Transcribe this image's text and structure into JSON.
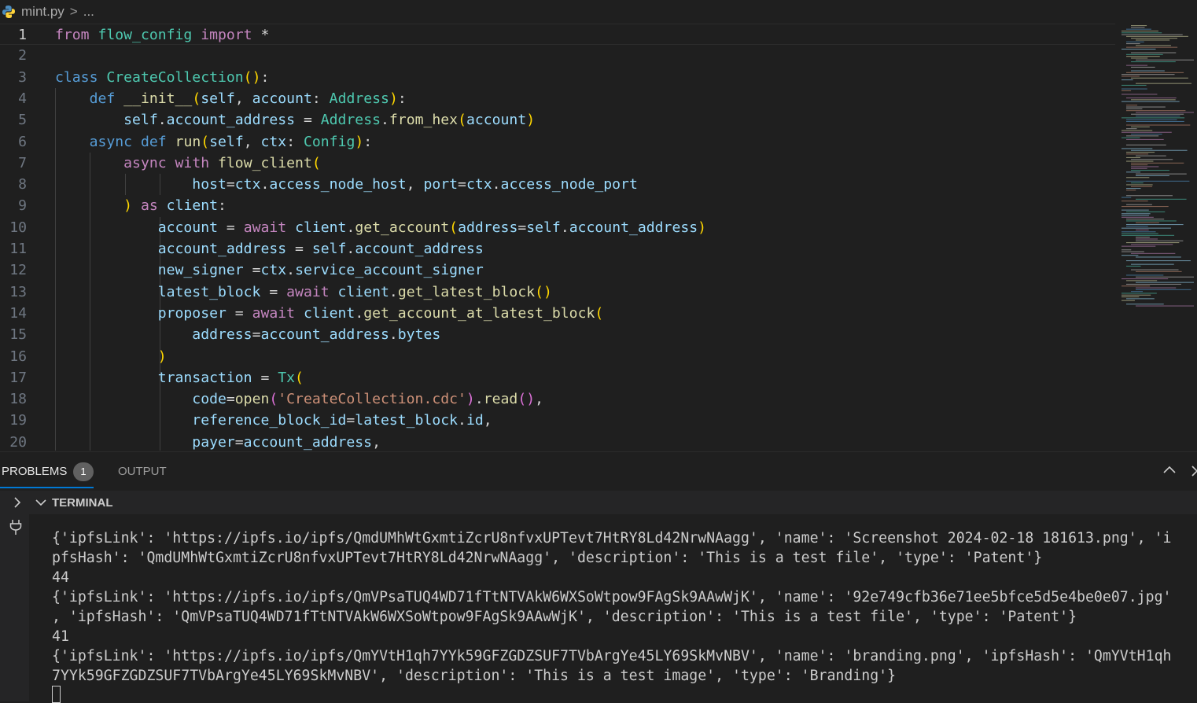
{
  "breadcrumb": {
    "file": "mint.py",
    "separator": ">",
    "ellipsis": "..."
  },
  "editor": {
    "current_line": 1,
    "lines": [
      {
        "n": "1"
      },
      {
        "n": "2"
      },
      {
        "n": "3"
      },
      {
        "n": "4"
      },
      {
        "n": "5"
      },
      {
        "n": "6"
      },
      {
        "n": "7"
      },
      {
        "n": "8"
      },
      {
        "n": "9"
      },
      {
        "n": "10"
      },
      {
        "n": "11"
      },
      {
        "n": "12"
      },
      {
        "n": "13"
      },
      {
        "n": "14"
      },
      {
        "n": "15"
      },
      {
        "n": "16"
      },
      {
        "n": "17"
      },
      {
        "n": "18"
      },
      {
        "n": "19"
      },
      {
        "n": "20"
      }
    ],
    "code": [
      [
        [
          "from",
          "kw"
        ],
        [
          " ",
          ""
        ],
        [
          "flow_config",
          "ty"
        ],
        [
          " ",
          ""
        ],
        [
          "import",
          "kw"
        ],
        [
          " *",
          "op"
        ]
      ],
      [],
      [
        [
          "class",
          "kw2"
        ],
        [
          " ",
          ""
        ],
        [
          "CreateCollection",
          "ty"
        ],
        [
          "()",
          "b1"
        ],
        [
          ":",
          "op"
        ]
      ],
      [
        [
          "    ",
          ""
        ],
        [
          "def",
          "kw2"
        ],
        [
          " ",
          ""
        ],
        [
          "__init__",
          "fn"
        ],
        [
          "(",
          "b1"
        ],
        [
          "self",
          "vr"
        ],
        [
          ", ",
          "op"
        ],
        [
          "account",
          "vr"
        ],
        [
          ": ",
          "op"
        ],
        [
          "Address",
          "ty"
        ],
        [
          ")",
          "b1"
        ],
        [
          ":",
          "op"
        ]
      ],
      [
        [
          "        ",
          ""
        ],
        [
          "self",
          "vr"
        ],
        [
          ".",
          "op"
        ],
        [
          "account_address",
          "vr"
        ],
        [
          " = ",
          "op"
        ],
        [
          "Address",
          "ty"
        ],
        [
          ".",
          "op"
        ],
        [
          "from_hex",
          "fn"
        ],
        [
          "(",
          "b1"
        ],
        [
          "account",
          "vr"
        ],
        [
          ")",
          "b1"
        ]
      ],
      [
        [
          "    ",
          ""
        ],
        [
          "async",
          "kw2"
        ],
        [
          " ",
          ""
        ],
        [
          "def",
          "kw2"
        ],
        [
          " ",
          ""
        ],
        [
          "run",
          "fn"
        ],
        [
          "(",
          "b1"
        ],
        [
          "self",
          "vr"
        ],
        [
          ", ",
          "op"
        ],
        [
          "ctx",
          "vr"
        ],
        [
          ": ",
          "op"
        ],
        [
          "Config",
          "ty"
        ],
        [
          ")",
          "b1"
        ],
        [
          ":",
          "op"
        ]
      ],
      [
        [
          "        ",
          ""
        ],
        [
          "async",
          "kw"
        ],
        [
          " ",
          ""
        ],
        [
          "with",
          "kw"
        ],
        [
          " ",
          ""
        ],
        [
          "flow_client",
          "fn"
        ],
        [
          "(",
          "b1"
        ]
      ],
      [
        [
          "                ",
          ""
        ],
        [
          "host",
          "vr"
        ],
        [
          "=",
          "op"
        ],
        [
          "ctx",
          "vr"
        ],
        [
          ".",
          "op"
        ],
        [
          "access_node_host",
          "vr"
        ],
        [
          ", ",
          "op"
        ],
        [
          "port",
          "vr"
        ],
        [
          "=",
          "op"
        ],
        [
          "ctx",
          "vr"
        ],
        [
          ".",
          "op"
        ],
        [
          "access_node_port",
          "vr"
        ]
      ],
      [
        [
          "        ",
          ""
        ],
        [
          ")",
          "b1"
        ],
        [
          " ",
          ""
        ],
        [
          "as",
          "kw"
        ],
        [
          " ",
          ""
        ],
        [
          "client",
          "vr"
        ],
        [
          ":",
          "op"
        ]
      ],
      [
        [
          "            ",
          ""
        ],
        [
          "account",
          "vr"
        ],
        [
          " = ",
          "op"
        ],
        [
          "await",
          "kw"
        ],
        [
          " ",
          ""
        ],
        [
          "client",
          "vr"
        ],
        [
          ".",
          "op"
        ],
        [
          "get_account",
          "fn"
        ],
        [
          "(",
          "b1"
        ],
        [
          "address",
          "vr"
        ],
        [
          "=",
          "op"
        ],
        [
          "self",
          "vr"
        ],
        [
          ".",
          "op"
        ],
        [
          "account_address",
          "vr"
        ],
        [
          ")",
          "b1"
        ]
      ],
      [
        [
          "            ",
          ""
        ],
        [
          "account_address",
          "vr"
        ],
        [
          " = ",
          "op"
        ],
        [
          "self",
          "vr"
        ],
        [
          ".",
          "op"
        ],
        [
          "account_address",
          "vr"
        ]
      ],
      [
        [
          "            ",
          ""
        ],
        [
          "new_signer",
          "vr"
        ],
        [
          " =",
          "op"
        ],
        [
          "ctx",
          "vr"
        ],
        [
          ".",
          "op"
        ],
        [
          "service_account_signer",
          "vr"
        ]
      ],
      [
        [
          "            ",
          ""
        ],
        [
          "latest_block",
          "vr"
        ],
        [
          " = ",
          "op"
        ],
        [
          "await",
          "kw"
        ],
        [
          " ",
          ""
        ],
        [
          "client",
          "vr"
        ],
        [
          ".",
          "op"
        ],
        [
          "get_latest_block",
          "fn"
        ],
        [
          "()",
          "b1"
        ]
      ],
      [
        [
          "            ",
          ""
        ],
        [
          "proposer",
          "vr"
        ],
        [
          " = ",
          "op"
        ],
        [
          "await",
          "kw"
        ],
        [
          " ",
          ""
        ],
        [
          "client",
          "vr"
        ],
        [
          ".",
          "op"
        ],
        [
          "get_account_at_latest_block",
          "fn"
        ],
        [
          "(",
          "b1"
        ]
      ],
      [
        [
          "                ",
          ""
        ],
        [
          "address",
          "vr"
        ],
        [
          "=",
          "op"
        ],
        [
          "account_address",
          "vr"
        ],
        [
          ".",
          "op"
        ],
        [
          "bytes",
          "vr"
        ]
      ],
      [
        [
          "            ",
          ""
        ],
        [
          ")",
          "b1"
        ]
      ],
      [
        [
          "            ",
          ""
        ],
        [
          "transaction",
          "vr"
        ],
        [
          " = ",
          "op"
        ],
        [
          "Tx",
          "ty"
        ],
        [
          "(",
          "b1"
        ]
      ],
      [
        [
          "                ",
          ""
        ],
        [
          "code",
          "vr"
        ],
        [
          "=",
          "op"
        ],
        [
          "open",
          "fn"
        ],
        [
          "(",
          "b2"
        ],
        [
          "'CreateCollection.cdc'",
          "st"
        ],
        [
          ")",
          "b2"
        ],
        [
          ".",
          "op"
        ],
        [
          "read",
          "fn"
        ],
        [
          "()",
          "b2"
        ],
        [
          ",",
          "op"
        ]
      ],
      [
        [
          "                ",
          ""
        ],
        [
          "reference_block_id",
          "vr"
        ],
        [
          "=",
          "op"
        ],
        [
          "latest_block",
          "vr"
        ],
        [
          ".",
          "op"
        ],
        [
          "id",
          "vr"
        ],
        [
          ",",
          "op"
        ]
      ],
      [
        [
          "                ",
          ""
        ],
        [
          "payer",
          "vr"
        ],
        [
          "=",
          "op"
        ],
        [
          "account_address",
          "vr"
        ],
        [
          ",",
          "op"
        ]
      ]
    ]
  },
  "panel": {
    "tabs": [
      {
        "label": "PROBLEMS",
        "badge": "1",
        "active": true
      },
      {
        "label": "OUTPUT",
        "active": false
      }
    ]
  },
  "terminal": {
    "title": "TERMINAL",
    "lines": [
      "{'ipfsLink': 'https://ipfs.io/ipfs/QmdUMhWtGxmtiZcrU8nfvxUPTevt7HtRY8Ld42NrwNAagg', 'name': 'Screenshot 2024-02-18 181613.png', 'i",
      "pfsHash': 'QmdUMhWtGxmtiZcrU8nfvxUPTevt7HtRY8Ld42NrwNAagg', 'description': 'This is a test file', 'type': 'Patent'}",
      "44",
      "{'ipfsLink': 'https://ipfs.io/ipfs/QmVPsaTUQ4WD71fTtNTVAkW6WXSoWtpow9FAgSk9AAwWjK', 'name': '92e749cfb36e71ee5bfce5d5e4be0e07.jpg'",
      ", 'ipfsHash': 'QmVPsaTUQ4WD71fTtNTVAkW6WXSoWtpow9FAgSk9AAwWjK', 'description': 'This is a test file', 'type': 'Patent'}",
      "41",
      "{'ipfsLink': 'https://ipfs.io/ipfs/QmYVtH1qh7YYk59GFZGDZSUF7TVbArgYe45LY69SkMvNBV', 'name': 'branding.png', 'ipfsHash': 'QmYVtH1qh",
      "7YYk59GFZGDZSUF7TVbArgYe45LY69SkMvNBV', 'description': 'This is a test image', 'type': 'Branding'}"
    ]
  },
  "colors": {
    "background": "#1f1f1f",
    "keyword": "#c586c0",
    "storage": "#569cd6",
    "type": "#4ec9b0",
    "function": "#dcdcaa",
    "variable": "#9cdcfe",
    "string": "#ce9178",
    "accent": "#0078d4"
  },
  "icons": [
    "python-file-icon",
    "chevron-right-icon",
    "chevron-up-icon",
    "close-icon",
    "chevron-down-icon",
    "plug-icon"
  ]
}
